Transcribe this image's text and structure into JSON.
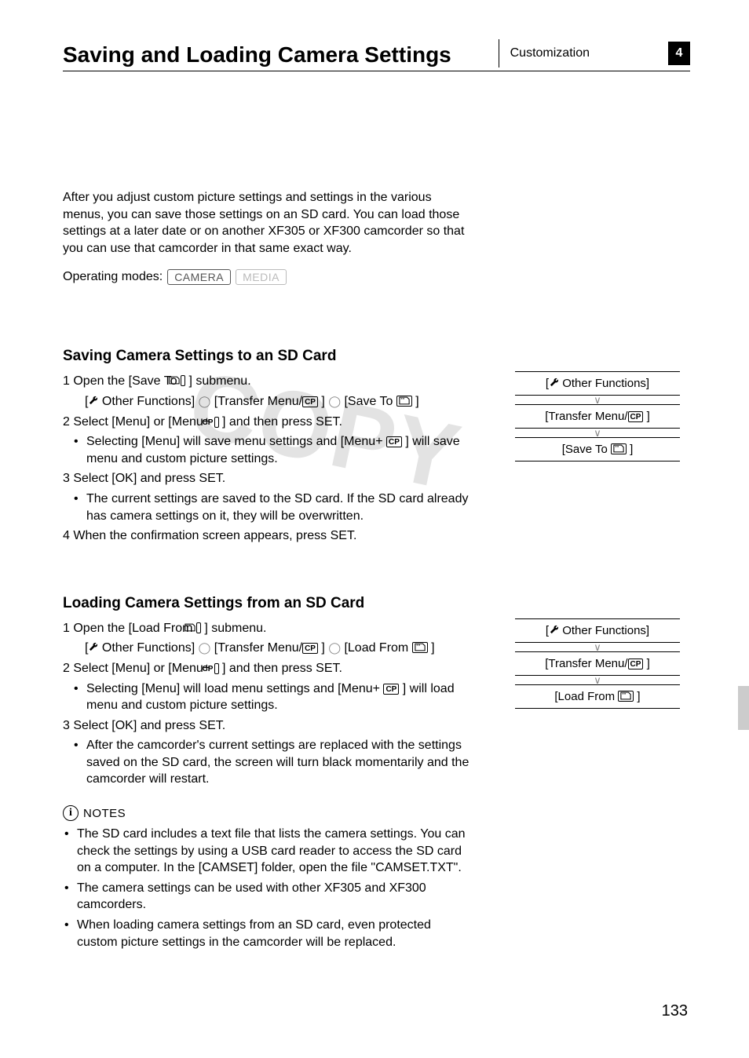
{
  "header": {
    "title": "Saving and Loading Camera Settings",
    "category": "Customization",
    "chapter_num": "4"
  },
  "intro": "After you adjust custom picture settings and settings in the various menus, you can save those settings on an SD card. You can load those settings at a later date or on another XF305 or XF300 camcorder so that you can use that camcorder in that same exact way.",
  "operating_modes": {
    "label": "Operating modes:",
    "modes": [
      "CAMERA",
      "MEDIA"
    ]
  },
  "saving": {
    "heading": "Saving Camera Settings to an SD Card",
    "step1": "1 Open the [Save To ",
    "step1_end": " ] submenu.",
    "path_pre": "[",
    "path_other": " Other Functions] ",
    "path_transfer": " [Transfer Menu/",
    "path_transfer_end": " ] ",
    "path_save": " [Save To ",
    "path_save_end": " ]",
    "step2": "2 Select [Menu] or [Menu+ ",
    "step2_end": " ] and then press SET.",
    "step2_sub1": "Selecting [Menu] will save menu settings and [Menu+ ",
    "step2_sub1_mid": " ] will save menu and custom picture settings.",
    "step3": "3 Select [OK] and press SET.",
    "step3_sub1": "The current settings are saved to the SD card. If the SD card already has camera settings on it, they will be overwritten.",
    "step4": "4 When the confirmation screen appears, press SET.",
    "menu": {
      "l1_pre": "[",
      "l1": " Other Functions]",
      "l2_pre": "[Transfer Menu/",
      "l2_post": " ]",
      "l3_pre": "[Save To ",
      "l3_post": " ]"
    }
  },
  "loading": {
    "heading": "Loading Camera Settings from an SD Card",
    "step1": "1 Open the [Load From ",
    "step1_end": " ] submenu.",
    "path_pre": "[",
    "path_other": " Other Functions] ",
    "path_transfer": " [Transfer Menu/",
    "path_transfer_end": " ] ",
    "path_load": " [Load From ",
    "path_load_end": " ]",
    "step2": "2 Select [Menu] or [Menu+ ",
    "step2_end": " ] and then press SET.",
    "step2_sub1": "Selecting [Menu] will load menu settings and [Menu+ ",
    "step2_sub1_mid": " ] will load menu and custom picture settings.",
    "step3": "3 Select [OK] and press SET.",
    "step3_sub1": "After the camcorder's current settings are replaced with the settings saved on the SD card, the screen will turn black momentarily and the camcorder will restart.",
    "menu": {
      "l1_pre": "[",
      "l1": " Other Functions]",
      "l2_pre": "[Transfer Menu/",
      "l2_post": " ]",
      "l3_pre": "[Load From ",
      "l3_post": " ]"
    }
  },
  "notes": {
    "label": "NOTES",
    "n1": "The SD card includes a text file that lists the camera settings. You can check the settings by using a USB card reader to access the SD card on a computer. In the [CAMSET] folder, open the file \"CAMSET.TXT\".",
    "n2": "The camera settings can be used with other XF305 and XF300 camcorders.",
    "n3": "When loading camera settings from an SD card, even protected custom picture settings in the camcorder will be replaced."
  },
  "watermark": "COPY",
  "page_number": "133",
  "icons": {
    "cp": "CP"
  }
}
